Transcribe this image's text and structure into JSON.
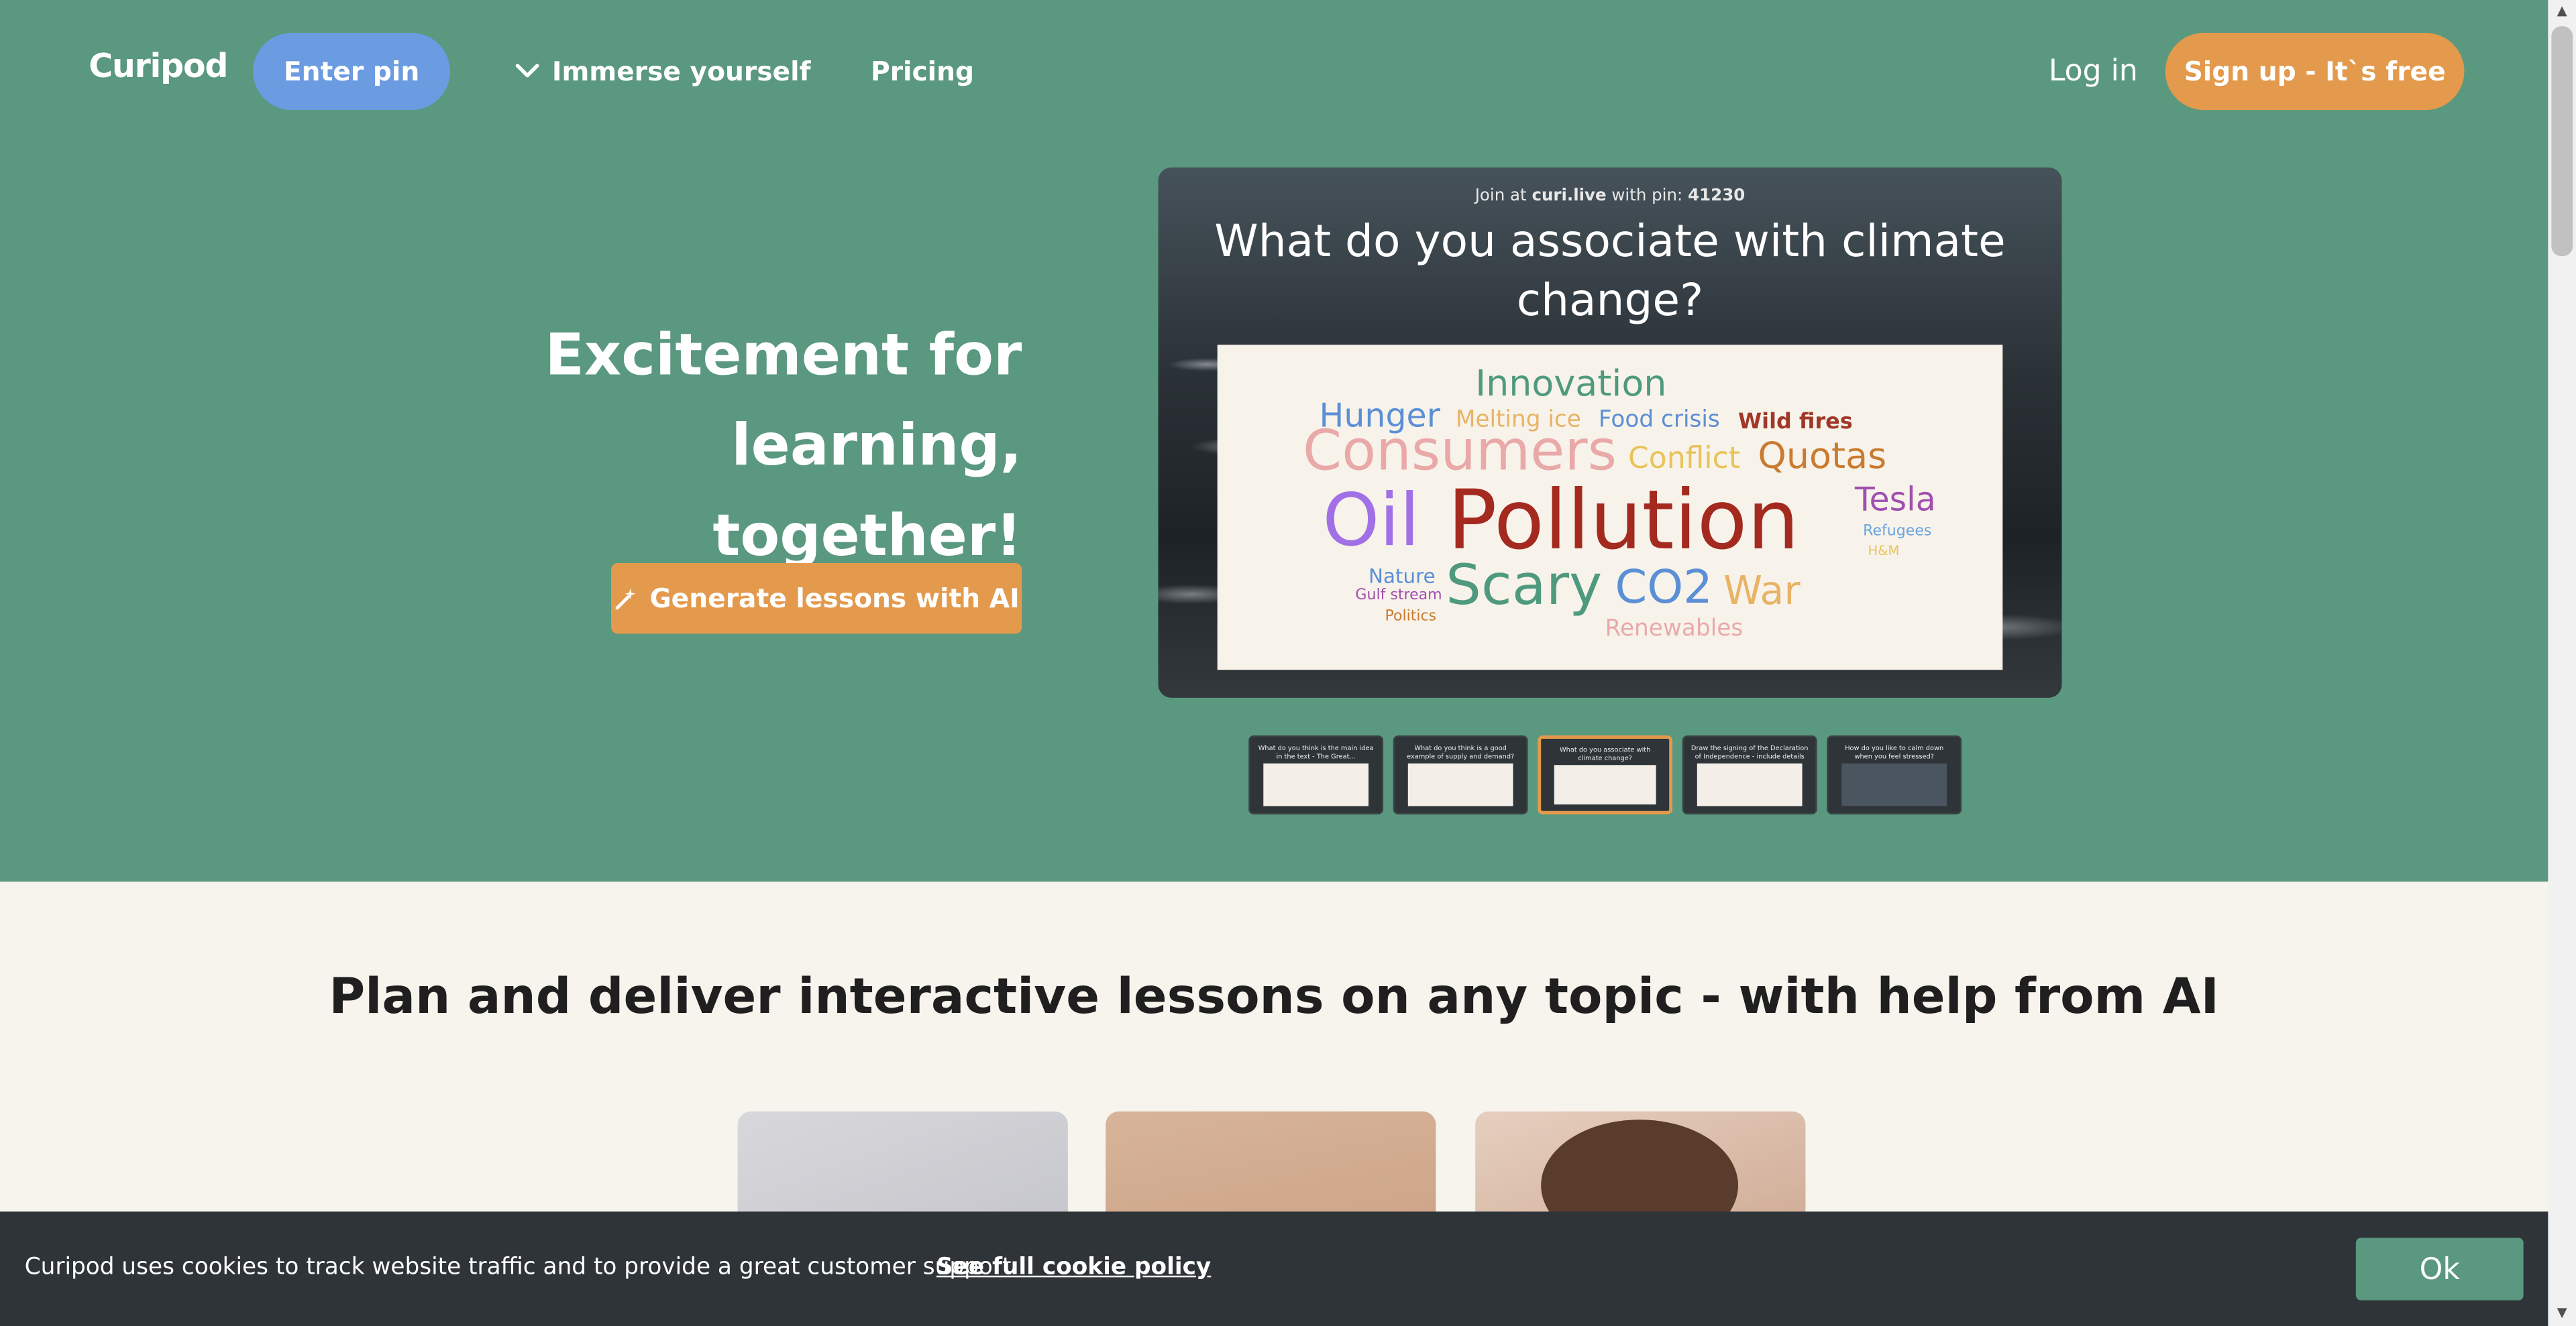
{
  "header": {
    "logo": "Curipod",
    "enter_pin": "Enter pin",
    "immerse": "Immerse yourself",
    "pricing": "Pricing",
    "login": "Log in",
    "signup": "Sign up - It`s free"
  },
  "hero": {
    "title_line1": "Excitement for",
    "title_line2": "learning, together!",
    "generate": "Generate lessons with AI"
  },
  "slide": {
    "join_prefix": "Join at",
    "join_site": "curi.live",
    "join_mid": "with pin:",
    "join_pin": "41230",
    "question": "What do you associate with climate change?",
    "words": [
      {
        "text": "Innovation",
        "color": "#4f9a7e"
      },
      {
        "text": "Hunger",
        "color": "#5b8fd6"
      },
      {
        "text": "Melting ice",
        "color": "#e8b365"
      },
      {
        "text": "Food crisis",
        "color": "#5b8fd6"
      },
      {
        "text": "Wild fires",
        "color": "#a0382a"
      },
      {
        "text": "Consumers",
        "color": "#e9a9a9"
      },
      {
        "text": "Conflict",
        "color": "#e8c35a"
      },
      {
        "text": "Quotas",
        "color": "#c97b2f"
      },
      {
        "text": "Oil",
        "color": "#a270e6"
      },
      {
        "text": "Pollution",
        "color": "#a42a20"
      },
      {
        "text": "Tesla",
        "color": "#a04fb0"
      },
      {
        "text": "Refugees",
        "color": "#6aa4e0"
      },
      {
        "text": "H&M",
        "color": "#e8c35a"
      },
      {
        "text": "Nature",
        "color": "#5b8fd6"
      },
      {
        "text": "Gulf stream",
        "color": "#a04fb0"
      },
      {
        "text": "Scary",
        "color": "#4f9a7e"
      },
      {
        "text": "CO2",
        "color": "#5b8fd6"
      },
      {
        "text": "War",
        "color": "#e8b365"
      },
      {
        "text": "Politics",
        "color": "#c97b2f"
      },
      {
        "text": "Renewables",
        "color": "#e9a9a9"
      }
    ]
  },
  "thumbnails": [
    {
      "title": "What do you think is the main idea in the text - The Great..."
    },
    {
      "title": "What do you think is a good example of supply and demand?"
    },
    {
      "title": "What do you associate with climate change?"
    },
    {
      "title": "Draw the signing of the Declaration of Independence - include details"
    },
    {
      "title": "How do you like to calm down when you feel stressed?"
    }
  ],
  "section": {
    "title": "Plan and deliver interactive lessons on any topic - with help from AI"
  },
  "cookie": {
    "text": "Curipod uses cookies to track website traffic and to provide a great customer support.",
    "link": "See full cookie policy",
    "ok": "Ok"
  },
  "colors": {
    "hero_bg": "#5a9880",
    "pin_button": "#6b9be0",
    "accent": "#e39a4c",
    "cookie_bg": "#2e3438"
  }
}
